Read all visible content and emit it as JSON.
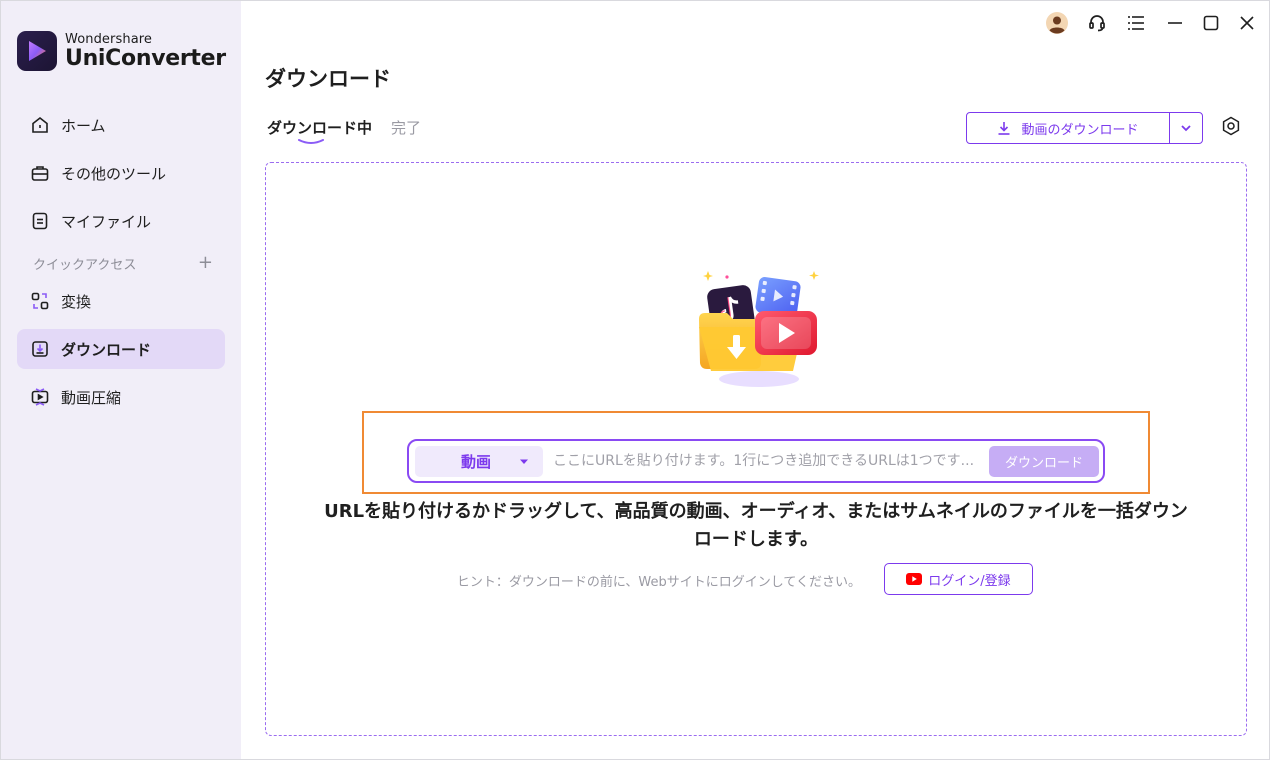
{
  "app": {
    "brand_small": "Wondershare",
    "brand_big": "UniConverter"
  },
  "sidebar": {
    "items": [
      {
        "label": "ホーム",
        "icon": "home-icon"
      },
      {
        "label": "その他のツール",
        "icon": "toolbox-icon"
      },
      {
        "label": "マイファイル",
        "icon": "file-icon"
      },
      {
        "label": "変換",
        "icon": "convert-icon"
      },
      {
        "label": "ダウンロード",
        "icon": "download-icon",
        "active": true
      },
      {
        "label": "動画圧縮",
        "icon": "compress-icon"
      }
    ],
    "quick_access_label": "クイックアクセス",
    "quick_access_add": "+"
  },
  "titlebar": {
    "icons": [
      "avatar-icon",
      "headset-icon",
      "menu-icon",
      "minimize-icon",
      "maximize-icon",
      "close-icon"
    ]
  },
  "main": {
    "title": "ダウンロード",
    "tabs": [
      {
        "label": "ダウンロード中",
        "active": true
      },
      {
        "label": "完了",
        "active": false
      }
    ],
    "download_button_label": "動画のダウンロード",
    "url_bar": {
      "type_label": "動画",
      "placeholder": "ここにURLを貼り付けます。1行につき追加できるURLは1つです...",
      "download_label": "ダウンロード"
    },
    "instruction": "URLを貼り付けるかドラッグして、高品質の動画、オーディオ、またはサムネイルのファイルを一括ダウンロードします。",
    "hint": "ヒント：ダウンロードの前に、Webサイトにログインしてください。",
    "login_label": "ログイン/登録"
  },
  "colors": {
    "accent": "#7c3aed",
    "sidebar_bg": "#f1eef8",
    "active_item_bg": "#e3d9f7",
    "highlight_border": "#f08a34",
    "youtube_red": "#ff0000"
  }
}
